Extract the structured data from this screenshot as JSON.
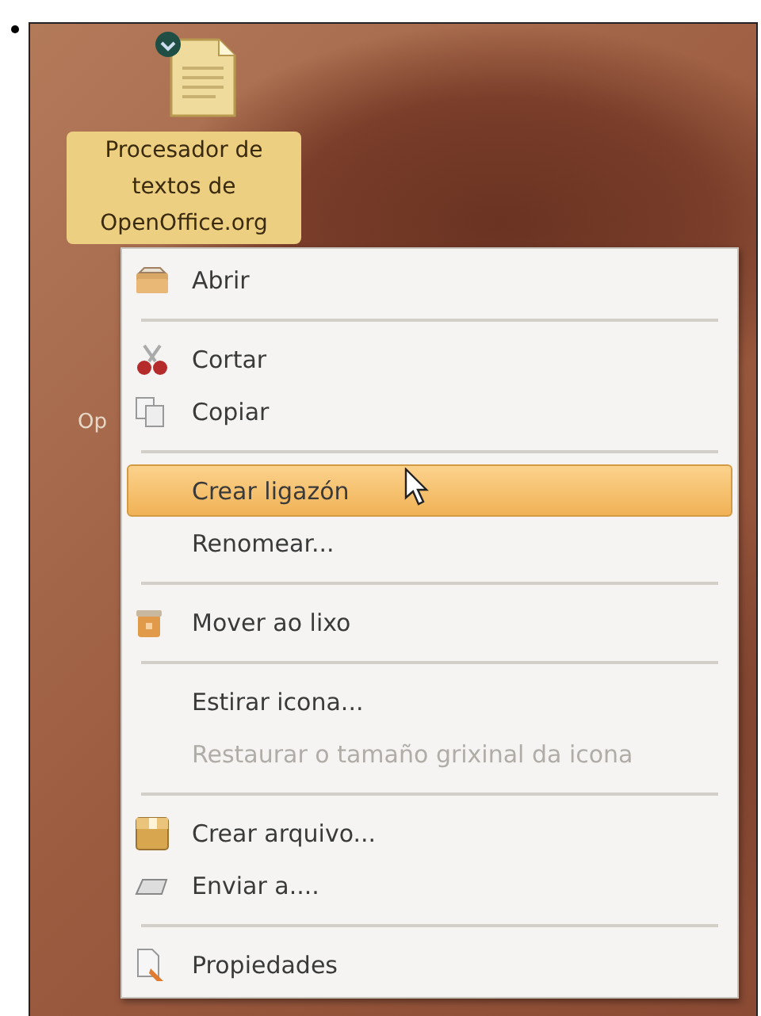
{
  "desktop": {
    "icon_label": "Procesador de textos de OpenOffice.org",
    "hidden_label": "Op"
  },
  "context_menu": {
    "items": [
      {
        "kind": "open",
        "label": "Abrir",
        "selected": false,
        "disabled": false
      },
      {
        "kind": "separator"
      },
      {
        "kind": "cut",
        "label": "Cortar",
        "selected": false,
        "disabled": false
      },
      {
        "kind": "copy",
        "label": "Copiar",
        "selected": false,
        "disabled": false
      },
      {
        "kind": "separator"
      },
      {
        "kind": "plain",
        "label": "Crear ligazón",
        "selected": true,
        "disabled": false
      },
      {
        "kind": "plain",
        "label": "Renomear...",
        "selected": false,
        "disabled": false
      },
      {
        "kind": "separator"
      },
      {
        "kind": "trash",
        "label": "Mover ao lixo",
        "selected": false,
        "disabled": false
      },
      {
        "kind": "separator"
      },
      {
        "kind": "plain",
        "label": "Estirar icona...",
        "selected": false,
        "disabled": false
      },
      {
        "kind": "plain",
        "label": "Restaurar o tamaño grixinal da icona",
        "selected": false,
        "disabled": true
      },
      {
        "kind": "separator"
      },
      {
        "kind": "archive",
        "label": "Crear arquivo...",
        "selected": false,
        "disabled": false
      },
      {
        "kind": "send",
        "label": "Enviar a....",
        "selected": false,
        "disabled": false
      },
      {
        "kind": "separator"
      },
      {
        "kind": "properties",
        "label": "Propiedades",
        "selected": false,
        "disabled": false
      }
    ]
  }
}
